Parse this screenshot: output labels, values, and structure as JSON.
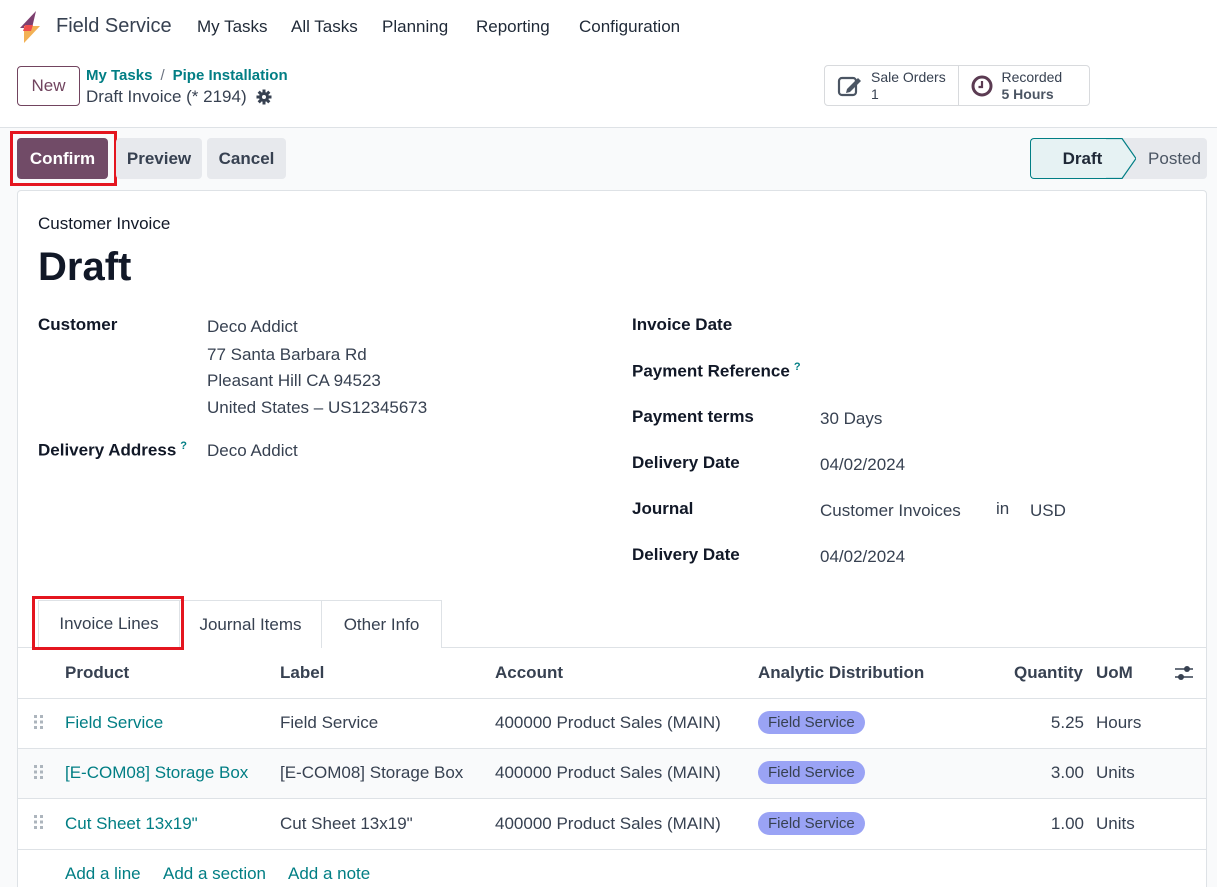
{
  "app": {
    "title": "Field Service",
    "nav": [
      "My Tasks",
      "All Tasks",
      "Planning",
      "Reporting",
      "Configuration"
    ]
  },
  "control_panel": {
    "new_label": "New",
    "breadcrumb": [
      "My Tasks",
      "Pipe Installation"
    ],
    "record_name": "Draft Invoice (* 2194)",
    "smart_buttons": [
      {
        "label": "Sale Orders",
        "value": "1",
        "icon": "edit-icon"
      },
      {
        "label": "Recorded",
        "value": "5 Hours",
        "icon": "clock-icon"
      }
    ]
  },
  "status_bar": {
    "buttons": [
      "Confirm",
      "Preview",
      "Cancel"
    ],
    "stages": [
      {
        "label": "Draft",
        "active": true
      },
      {
        "label": "Posted",
        "active": false
      }
    ]
  },
  "form": {
    "type_label": "Customer Invoice",
    "title": "Draft",
    "left": {
      "customer_label": "Customer",
      "customer_lines": [
        "Deco Addict",
        "77 Santa Barbara Rd",
        "Pleasant Hill CA 94523",
        "United States – US12345673"
      ],
      "delivery_address_label": "Delivery Address",
      "delivery_address_help": "?",
      "delivery_address_value": "Deco Addict"
    },
    "right": {
      "invoice_date_label": "Invoice Date",
      "invoice_date_value": "",
      "payment_reference_label": "Payment Reference",
      "payment_reference_help": "?",
      "payment_terms_label": "Payment terms",
      "payment_terms_value": "30 Days",
      "delivery_date_label": "Delivery Date",
      "delivery_date_value": "04/02/2024",
      "journal_label": "Journal",
      "journal_value": "Customer Invoices",
      "journal_in": "in",
      "journal_currency": "USD",
      "delivery_date2_label": "Delivery Date",
      "delivery_date2_value": "04/02/2024"
    }
  },
  "tabs": [
    "Invoice Lines",
    "Journal Items",
    "Other Info"
  ],
  "lines_table": {
    "columns": [
      "Product",
      "Label",
      "Account",
      "Analytic Distribution",
      "Quantity",
      "UoM"
    ],
    "rows": [
      {
        "product": "Field Service",
        "label": "Field Service",
        "account": "400000 Product Sales (MAIN)",
        "analytic": "Field Service",
        "quantity": "5.25",
        "uom": "Hours"
      },
      {
        "product": "[E-COM08] Storage Box",
        "label": "[E-COM08] Storage Box",
        "account": "400000 Product Sales (MAIN)",
        "analytic": "Field Service",
        "quantity": "3.00",
        "uom": "Units"
      },
      {
        "product": "Cut Sheet 13x19\"",
        "label": "Cut Sheet 13x19\"",
        "account": "400000 Product Sales (MAIN)",
        "analytic": "Field Service",
        "quantity": "1.00",
        "uom": "Units"
      }
    ],
    "add_links": [
      "Add a line",
      "Add a section",
      "Add a note"
    ]
  },
  "colors": {
    "brand": "#714b67",
    "link": "#017e84",
    "tag": "#9aa3f5",
    "highlight": "#e4151f"
  }
}
